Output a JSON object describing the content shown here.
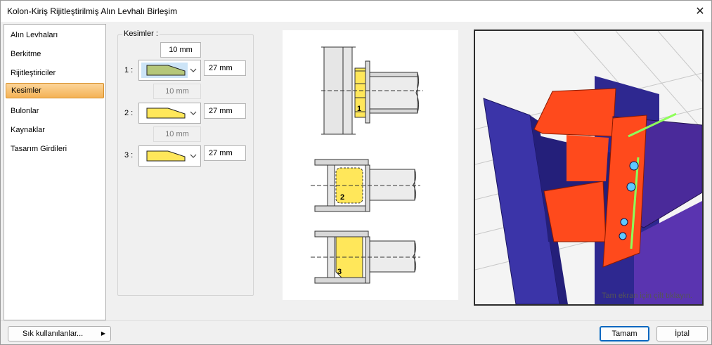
{
  "window": {
    "title": "Kolon-Kiriş Rijitleştirilmiş Alın Levhalı Birleşim"
  },
  "sidebar": {
    "items": [
      {
        "label": "Alın Levhaları"
      },
      {
        "label": "Berkitme"
      },
      {
        "label": "Rijitleştiriciler"
      },
      {
        "label": "Kesimler",
        "active": true
      },
      {
        "label": "Bulonlar"
      },
      {
        "label": "Kaynaklar"
      },
      {
        "label": "Tasarım Girdileri"
      }
    ]
  },
  "cuts": {
    "group_label": "Kesimler :",
    "top_offset": "10 mm",
    "rows": [
      {
        "label": "1 :",
        "value": "27 mm",
        "spacer": "10 mm"
      },
      {
        "label": "2 :",
        "value": "27 mm",
        "spacer": "10 mm"
      },
      {
        "label": "3 :",
        "value": "27 mm"
      }
    ]
  },
  "diagram": {
    "labels": [
      "1",
      "2",
      "3"
    ]
  },
  "view3d": {
    "hint": "Tam ekran için çift tıklayın."
  },
  "footer": {
    "favorites_label": "Sık kullanılanlar...",
    "ok_label": "Tamam",
    "cancel_label": "İptal"
  },
  "colors": {
    "accent": "#0067c0",
    "active_tab": "#f4b255",
    "cut_yellow": "#ffe75a",
    "cut_green": "#b5c77a",
    "column_blue": "#3b34a8",
    "plate_red": "#ff4a1c",
    "beam_purple": "#4a2a9a"
  }
}
